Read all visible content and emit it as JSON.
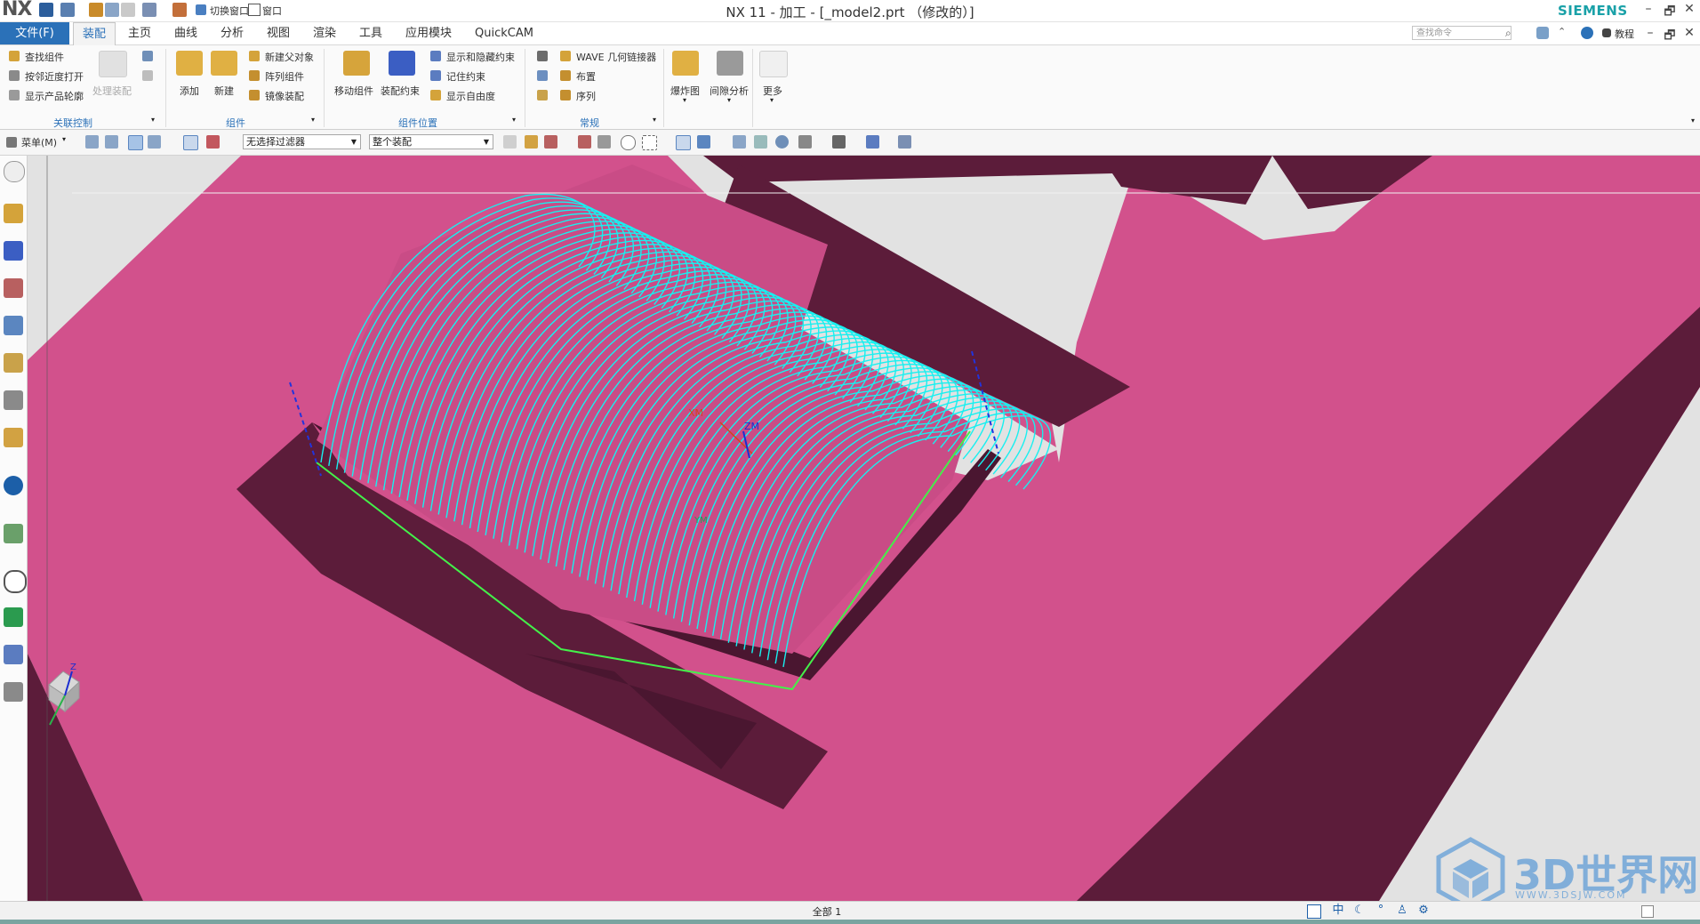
{
  "window": {
    "app_logo": "NX",
    "title": "NX 11 - 加工 - [_model2.prt （修改的）]",
    "brand": "SIEMENS",
    "quick_access": {
      "switch_window": "切换窗口",
      "window_menu": "窗口"
    },
    "controls": {
      "minimize": "–",
      "restore": "🗗",
      "close": "✕"
    }
  },
  "tabs": {
    "file": "文件(F)",
    "items": [
      "装配",
      "主页",
      "曲线",
      "分析",
      "视图",
      "渲染",
      "工具",
      "应用模块",
      "QuickCAM"
    ],
    "active": "装配",
    "search_placeholder": "查找命令",
    "help_label": "教程"
  },
  "ribbon": {
    "groups": {
      "assoc_control": {
        "label": "关联控制",
        "items": [
          "查找组件",
          "按邻近度打开",
          "显示产品轮廓"
        ],
        "disabled_button": "处理装配"
      },
      "component": {
        "label": "组件",
        "add": "添加",
        "new": "新建",
        "items": [
          "新建父对象",
          "阵列组件",
          "镜像装配"
        ]
      },
      "component_position": {
        "label": "组件位置",
        "move": "移动组件",
        "constraint": "装配约束",
        "items": [
          "显示和隐藏约束",
          "记住约束",
          "显示自由度"
        ]
      },
      "general": {
        "label": "常规",
        "items": [
          "WAVE 几何链接器",
          "布置",
          "序列"
        ],
        "exploded": "爆炸图",
        "clearance": "间隙分析",
        "more": "更多"
      }
    }
  },
  "toolbar2": {
    "menu": "菜单(M)",
    "filter": "无选择过滤器",
    "scope": "整个装配"
  },
  "viewport": {
    "wcs_labels": {
      "xm": "XM",
      "zm": "ZM",
      "ym": "YM"
    },
    "triad_label": "Z"
  },
  "statusbar": {
    "text": "全部 1",
    "icons": [
      "checkbox-icon",
      "中",
      "moon-icon",
      "dots-icon",
      "person-icon",
      "gear-icon"
    ]
  },
  "watermark": {
    "brand": "3D世界网",
    "url": "WWW.3DSJW.COM"
  },
  "colors": {
    "accent": "#2b71b8",
    "model_face": "#d2518c",
    "model_wall": "#5c1c3a",
    "floor": "#e2e2e2",
    "toolpath": "#18f0f0"
  }
}
